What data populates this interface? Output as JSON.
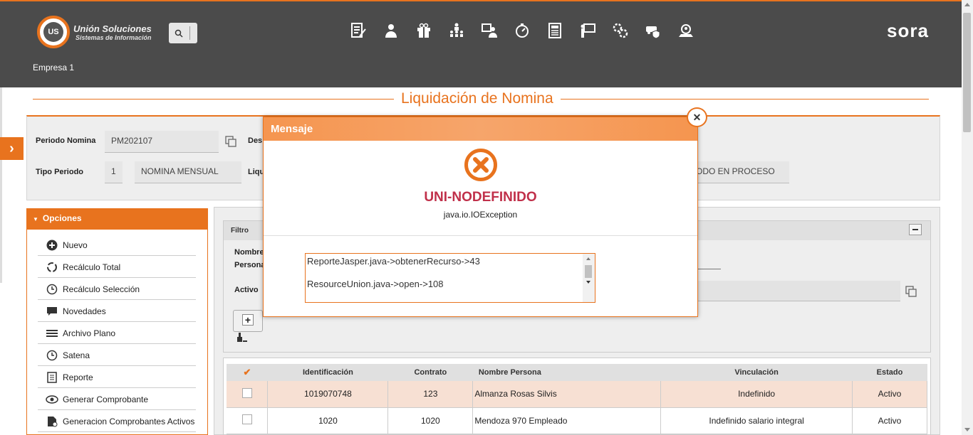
{
  "header": {
    "brand_name": "Unión Soluciones",
    "brand_tagline": "Sistemas de Información",
    "logo_text": "US",
    "sora_logo": "sora",
    "empresa": "Empresa 1",
    "menu_icons": [
      "document-edit-icon",
      "user-icon",
      "gift-icon",
      "org-chart-icon",
      "person-board-icon",
      "timer-icon",
      "report-icon",
      "presenter-icon",
      "gears-icon",
      "car-shield-icon",
      "search-user-icon"
    ]
  },
  "page": {
    "title": "Liquidación de Nomina"
  },
  "form": {
    "periodo_label": "Periodo Nomina",
    "periodo_value": "PM202107",
    "desc_label": "Des",
    "tipo_label": "Tipo Periodo",
    "tipo_code": "1",
    "tipo_value": "NOMINA MENSUAL",
    "liq_label": "Liqu",
    "estado_value": "ODO EN PROCESO"
  },
  "options": {
    "header": "Opciones",
    "items": [
      "Nuevo",
      "Recálculo Total",
      "Recálculo Selección",
      "Novedades",
      "Archivo Plano",
      "Satena",
      "Reporte",
      "Generar Comprobante",
      "Generacion Comprobantes Activos"
    ]
  },
  "filter": {
    "header": "Filtro",
    "nombre_label": "Nombre",
    "persona_label": "Persona",
    "activo_label": "Activo"
  },
  "table": {
    "columns": [
      "Identificación",
      "Contrato",
      "Nombre Persona",
      "Vinculación",
      "Estado"
    ],
    "rows": [
      {
        "id": "1019070748",
        "contrato": "123",
        "nombre": "Almanza Rosas Silvis",
        "vinculacion": "Indefinido",
        "estado": "Activo"
      },
      {
        "id": "1020",
        "contrato": "1020",
        "nombre": "Mendoza 970 Empleado",
        "vinculacion": "Indefinido salario integral",
        "estado": "Activo"
      }
    ]
  },
  "modal": {
    "title": "Mensaje",
    "error_code": "UNI-NODEFINIDO",
    "error_type": "java.io.IOException",
    "trace_line1": "ReporteJasper.java->obtenerRecurso->43",
    "trace_line2": "ResourceUnion.java->open->108"
  },
  "colors": {
    "accent": "#e8731e",
    "header_bg": "#4b4b4b",
    "error_red": "#c0304a"
  }
}
